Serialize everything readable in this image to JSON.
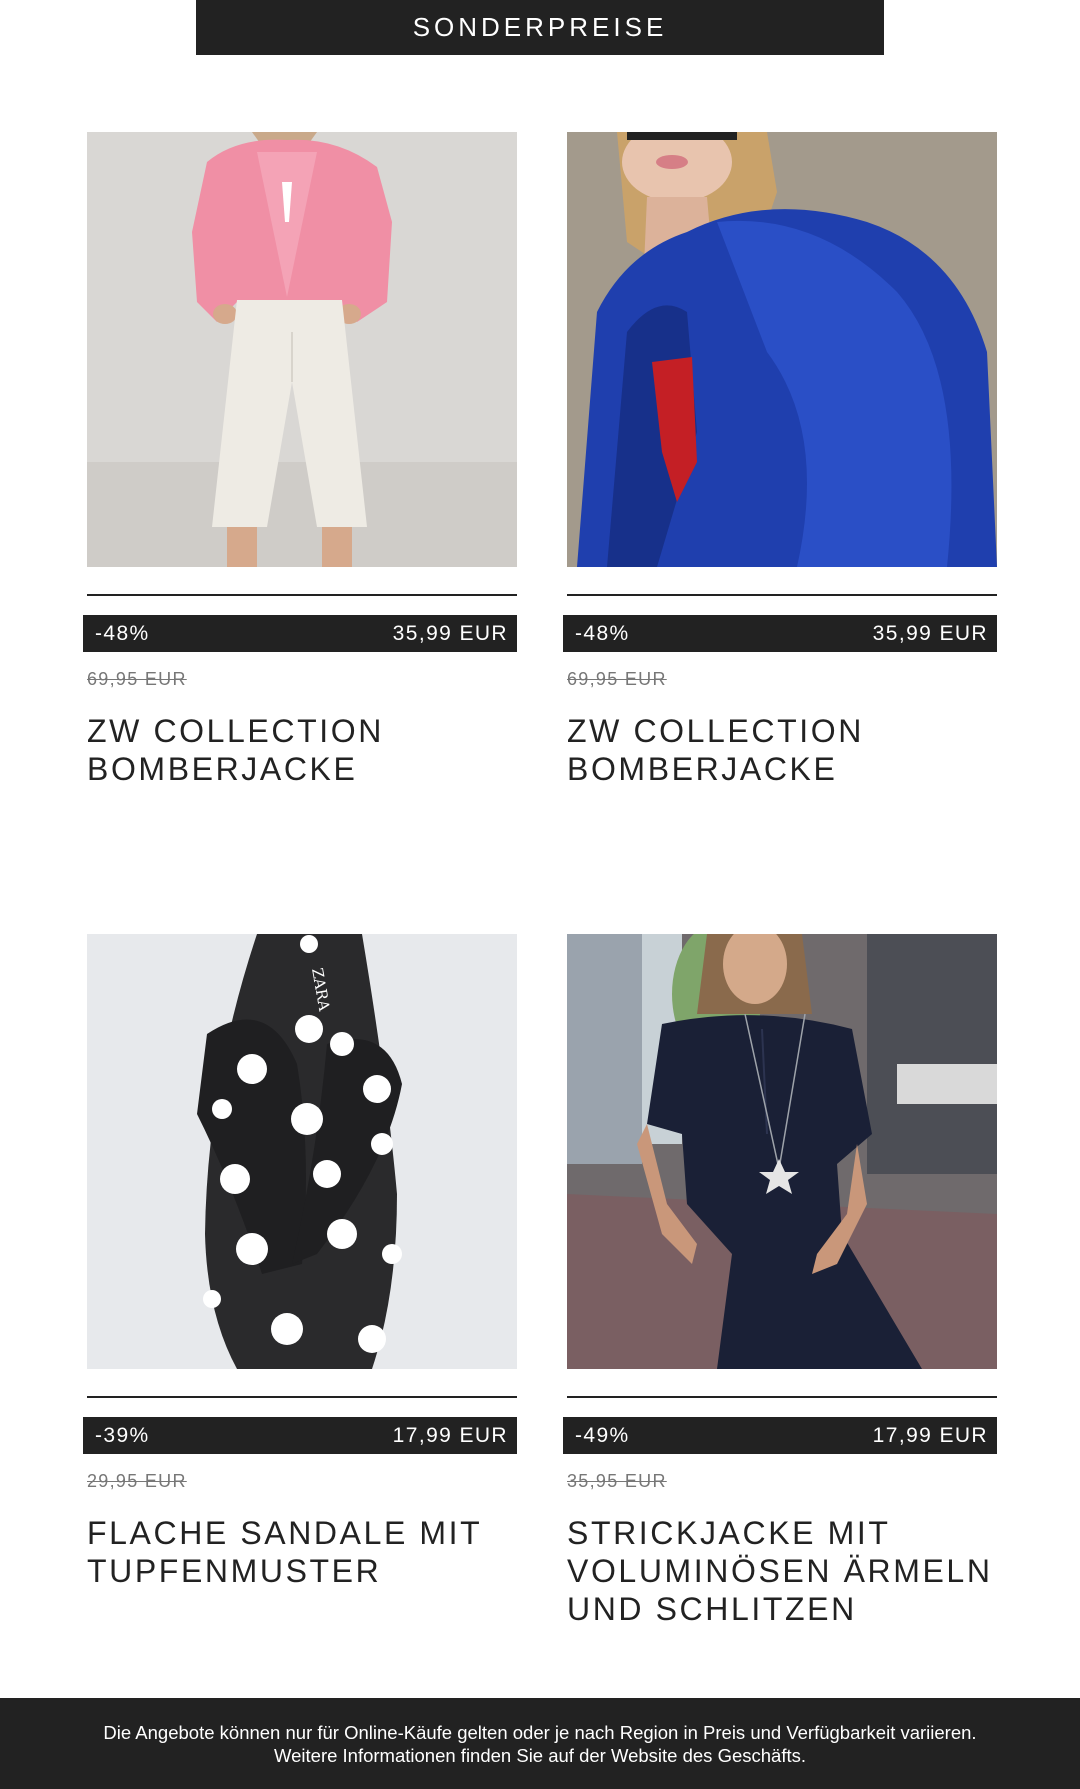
{
  "banner": {
    "label": "SONDERPREISE"
  },
  "products": [
    {
      "discount": "-48%",
      "price": "35,99 EUR",
      "old_price": "69,95 EUR",
      "title_line1": "ZW COLLECTION",
      "title_line2": "BOMBERJACKE",
      "title_line3": "",
      "image_icon": "photo-model-pink-jacket"
    },
    {
      "discount": "-48%",
      "price": "35,99 EUR",
      "old_price": "69,95 EUR",
      "title_line1": "ZW COLLECTION",
      "title_line2": "BOMBERJACKE",
      "title_line3": "",
      "image_icon": "photo-model-blue-jacket"
    },
    {
      "discount": "-39%",
      "price": "17,99 EUR",
      "old_price": "29,95 EUR",
      "title_line1": "FLACHE SANDALE MIT",
      "title_line2": "TUPFENMUSTER",
      "title_line3": "",
      "image_icon": "photo-polka-dot-sandal",
      "image_logo_text": "ZARA"
    },
    {
      "discount": "-49%",
      "price": "17,99 EUR",
      "old_price": "35,95 EUR",
      "title_line1": "STRICKJACKE MIT",
      "title_line2": "VOLUMINÖSEN ÄRMELN",
      "title_line3": "UND SCHLITZEN",
      "image_icon": "photo-model-navy-knit"
    }
  ],
  "footer": {
    "line1": "Die Angebote können nur für Online-Käufe gelten oder je nach Region in Preis und Verfügbarkeit variieren.",
    "line2": "Weitere Informationen finden Sie auf der Website des Geschäfts."
  },
  "colors": {
    "dark": "#222222",
    "white": "#ffffff",
    "muted": "#777777"
  }
}
